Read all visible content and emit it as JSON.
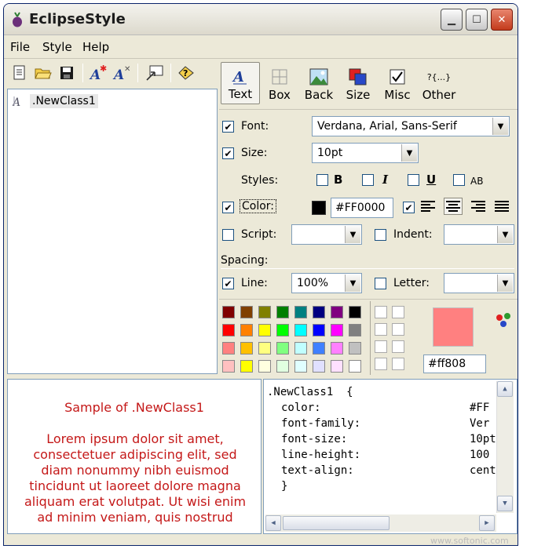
{
  "window": {
    "title": "EclipseStyle"
  },
  "menu": [
    "File",
    "Style",
    "Help"
  ],
  "tree": {
    "item": ".NewClass1"
  },
  "tabs": [
    {
      "label": "Text",
      "icon": "text-tab-icon",
      "selected": true
    },
    {
      "label": "Box",
      "icon": "box-tab-icon"
    },
    {
      "label": "Back",
      "icon": "background-tab-icon"
    },
    {
      "label": "Size",
      "icon": "size-tab-icon"
    },
    {
      "label": "Misc",
      "icon": "misc-tab-icon"
    },
    {
      "label": "Other",
      "icon": "other-tab-icon"
    }
  ],
  "other_icon_glyph": "?{...}",
  "props": {
    "font": {
      "label": "Font:",
      "value": "Verdana, Arial, Sans-Serif",
      "checked": true
    },
    "size": {
      "label": "Size:",
      "value": "10pt",
      "checked": true
    },
    "styles": {
      "label": "Styles:",
      "bold": "B",
      "italic": "I",
      "underline": "U",
      "smallcaps": "AB"
    },
    "color": {
      "label": "Color:",
      "value": "#FF0000",
      "checked": true,
      "swatch": "#000000"
    },
    "script": {
      "label": "Script:",
      "value": "",
      "checked": false
    },
    "indent": {
      "label": "Indent:",
      "value": "",
      "checked": false
    },
    "spacing_label": "Spacing:",
    "line": {
      "label": "Line:",
      "value": "100%",
      "checked": true
    },
    "letter": {
      "label": "Letter:",
      "value": "",
      "checked": false
    }
  },
  "check_mark": "✔",
  "palette": {
    "colors": [
      [
        "#800000",
        "#804000",
        "#808000",
        "#008000",
        "#008080",
        "#000080",
        "#800080",
        "#000000"
      ],
      [
        "#ff0000",
        "#ff8000",
        "#ffff00",
        "#00ff00",
        "#00ffff",
        "#0000ff",
        "#ff00ff",
        "#808080"
      ],
      [
        "#ff8080",
        "#ffc000",
        "#ffff80",
        "#80ff80",
        "#c0ffff",
        "#4080ff",
        "#ff80ff",
        "#c0c0c0"
      ],
      [
        "#ffc0c0",
        "#ffff00",
        "#ffffe0",
        "#e0ffe0",
        "#e0ffff",
        "#e0e0ff",
        "#ffe0ff",
        "#ffffff"
      ]
    ],
    "current_color": "#ff8080",
    "current_hex": "#ff808"
  },
  "preview": {
    "title": "Sample of .NewClass1",
    "body": "Lorem ipsum dolor sit amet, consectetuer adipiscing elit, sed diam nonummy nibh euismod tincidunt ut laoreet dolore magna aliquam erat volutpat. Ut wisi enim ad minim veniam, quis nostrud"
  },
  "code": {
    "selector": ".NewClass1  {",
    "props": [
      {
        "name": "color:",
        "value": "#FF"
      },
      {
        "name": "font-family:",
        "value": "Ver"
      },
      {
        "name": "font-size:",
        "value": "10pt"
      },
      {
        "name": "line-height:",
        "value": "100"
      },
      {
        "name": "text-align:",
        "value": "cent"
      }
    ],
    "close": "}"
  },
  "watermark": "www.softonic.com"
}
